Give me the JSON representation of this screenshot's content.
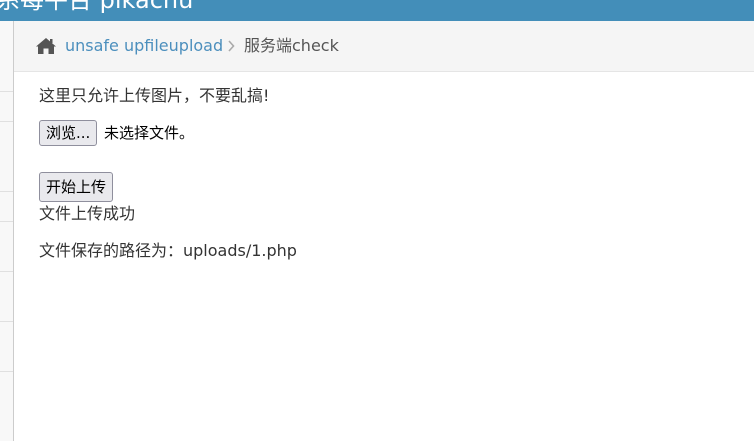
{
  "header": {
    "title": "系每平台 pikachu"
  },
  "breadcrumb": {
    "home_icon": "home-icon",
    "link_label": "unsafe upfileupload",
    "separator_icon": "chevron-right-icon",
    "current_label": "服务端check"
  },
  "main": {
    "notice": "这里只允许上传图片，不要乱搞!",
    "file_input": {
      "browse_label": "浏览...",
      "status": "未选择文件。"
    },
    "upload_button_label": "开始上传",
    "result_success": "文件上传成功",
    "result_path": "文件保存的路径为：uploads/1.php"
  },
  "colors": {
    "header_bg": "#438eb9",
    "breadcrumb_bg": "#f5f5f5",
    "link": "#4c8fbd"
  }
}
